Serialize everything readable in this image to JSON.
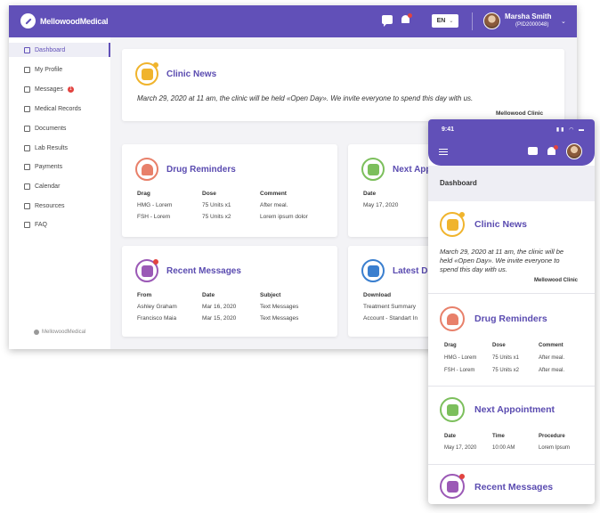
{
  "brand": {
    "name": "MellowoodMedical",
    "footer": "MellowoodMedical"
  },
  "topbar": {
    "language": "EN",
    "user_name": "Marsha Smith",
    "user_id": "(PID2000048)"
  },
  "colors": {
    "primary": "#6150b8",
    "alert": "#e2433f",
    "news": "#f0b42d",
    "drug": "#e8806a",
    "appointment": "#7cbf5c",
    "messages": "#9b59b6",
    "documents": "#3a7fcf"
  },
  "sidebar": {
    "items": [
      {
        "label": "Dashboard",
        "icon": "home-icon"
      },
      {
        "label": "My Profile",
        "icon": "user-icon"
      },
      {
        "label": "Messages",
        "icon": "mail-icon",
        "badge": "1"
      },
      {
        "label": "Medical Records",
        "icon": "records-icon"
      },
      {
        "label": "Documents",
        "icon": "document-icon"
      },
      {
        "label": "Lab Results",
        "icon": "lab-icon"
      },
      {
        "label": "Payments",
        "icon": "payment-icon"
      },
      {
        "label": "Calendar",
        "icon": "calendar-icon"
      },
      {
        "label": "Resources",
        "icon": "folder-icon"
      },
      {
        "label": "FAQ",
        "icon": "help-icon"
      }
    ]
  },
  "desktop": {
    "news": {
      "title": "Clinic News",
      "text": "March 29, 2020 at 11 am, the clinic will be held «Open Day». We invite everyone to spend this day with us.",
      "sign": "Mellowood Clinic"
    },
    "drugs": {
      "title": "Drug Reminders",
      "headers": [
        "Drag",
        "Dose",
        "Comment"
      ],
      "rows": [
        [
          "HMG - Lorem",
          "75 Units x1",
          "After meal."
        ],
        [
          "FSH - Lorem",
          "75 Units x2",
          "Lorem ipsum dolor"
        ]
      ]
    },
    "appointment": {
      "title": "Next App",
      "headers": [
        "Date"
      ],
      "rows": [
        [
          "May 17, 2020"
        ]
      ]
    },
    "messages": {
      "title": "Recent Messages",
      "headers": [
        "From",
        "Date",
        "Subject"
      ],
      "rows": [
        [
          "Ashley Graham",
          "Mar 16, 2020",
          "Text Messages"
        ],
        [
          "Francisco Maia",
          "Mar 15, 2020",
          "Text Messages"
        ]
      ]
    },
    "documents": {
      "title": "Latest Do",
      "headers": [
        "Download"
      ],
      "rows": [
        [
          "Treatment Summary"
        ],
        [
          "Account - Standart In"
        ]
      ]
    }
  },
  "mobile": {
    "time": "9:41",
    "page_title": "Dashboard",
    "news": {
      "title": "Clinic News",
      "lines": [
        "March 29, 2020 at 11 am, the clinic will be",
        "held «Open Day». We invite everyone to",
        "spend this day with us."
      ],
      "sign": "Mellowood Clinic"
    },
    "drugs": {
      "title": "Drug Reminders",
      "headers": [
        "Drag",
        "Dose",
        "Comment"
      ],
      "rows": [
        [
          "HMG - Lorem",
          "75 Units x1",
          "After meal."
        ],
        [
          "FSH - Lorem",
          "75 Units x2",
          "After meal."
        ]
      ]
    },
    "appointment": {
      "title": "Next Appointment",
      "headers": [
        "Date",
        "Time",
        "Procedure"
      ],
      "rows": [
        [
          "May 17, 2020",
          "10:00 AM",
          "Lorem Ipsum"
        ]
      ]
    },
    "messages": {
      "title": "Recent Messages"
    }
  }
}
